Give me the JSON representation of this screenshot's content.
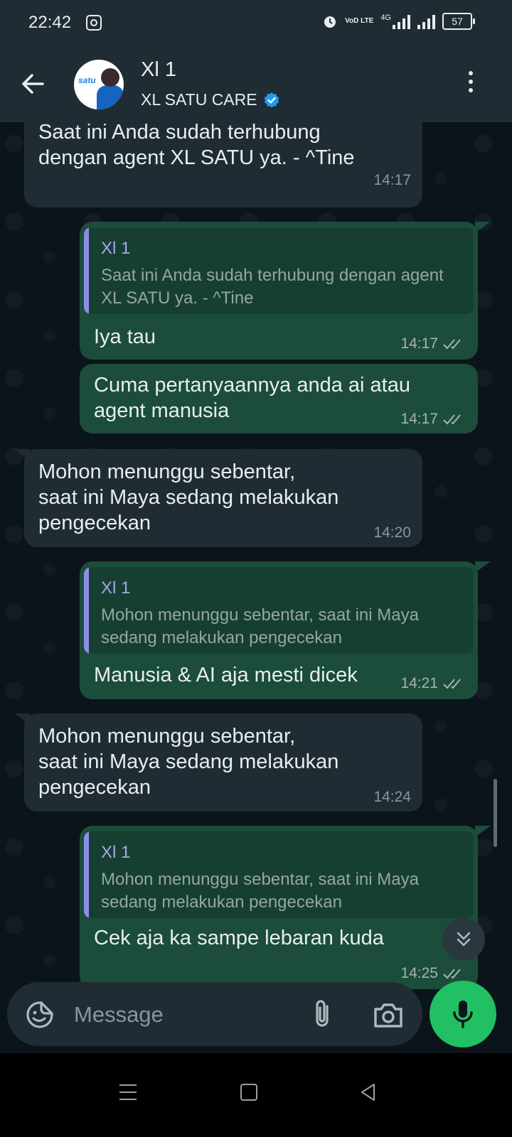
{
  "status_bar": {
    "time": "22:42",
    "network_label": "VoD LTE",
    "signal_1_label": "4G",
    "battery": "57"
  },
  "header": {
    "contact_name": "Xl 1",
    "contact_subtitle": "XL SATU CARE",
    "avatar_logo": "satu",
    "verified": true
  },
  "messages": [
    {
      "direction": "in",
      "text": "Saat ini Anda sudah terhubung\ndengan agent XL SATU ya.  - ^Tine",
      "time": "14:17"
    },
    {
      "direction": "out",
      "quote_name": "Xl 1",
      "quote_text": "Saat ini Anda sudah terhubung dengan agent XL SATU ya.  - ^Tine",
      "text": "Iya tau",
      "time": "14:17"
    },
    {
      "direction": "out",
      "text": "Cuma pertanyaannya anda ai atau agent manusia",
      "time": "14:17"
    },
    {
      "direction": "in",
      "text": "Mohon menunggu sebentar,\nsaat ini Maya sedang melakukan\npengecekan",
      "time": "14:20"
    },
    {
      "direction": "out",
      "quote_name": "Xl 1",
      "quote_text": "Mohon menunggu sebentar, saat ini Maya sedang melakukan pengecekan",
      "text": "Manusia & AI aja mesti dicek",
      "time": "14:21"
    },
    {
      "direction": "in",
      "text": "Mohon menunggu sebentar,\nsaat ini Maya sedang melakukan\npengecekan",
      "time": "14:24"
    },
    {
      "direction": "out",
      "quote_name": "Xl 1",
      "quote_text": "Mohon menunggu sebentar, saat ini Maya sedang melakukan pengecekan",
      "text": "Cek aja ka sampe lebaran kuda",
      "time": "14:25"
    }
  ],
  "composer": {
    "placeholder": "Message"
  },
  "icons": {
    "back": "arrow-left-icon",
    "menu": "more-vertical-icon",
    "emoji": "sticker-icon",
    "attach": "paperclip-icon",
    "camera": "camera-icon",
    "mic": "mic-icon",
    "scroll": "double-chevron-down-icon"
  },
  "colors": {
    "background": "#0b141a",
    "header": "#1f2c34",
    "incoming_bubble": "#202c33",
    "outgoing_bubble": "#1b4d3a",
    "accent_green": "#21c063",
    "quote_bar": "#8f8ce8",
    "verified_blue": "#1d9bf0"
  }
}
